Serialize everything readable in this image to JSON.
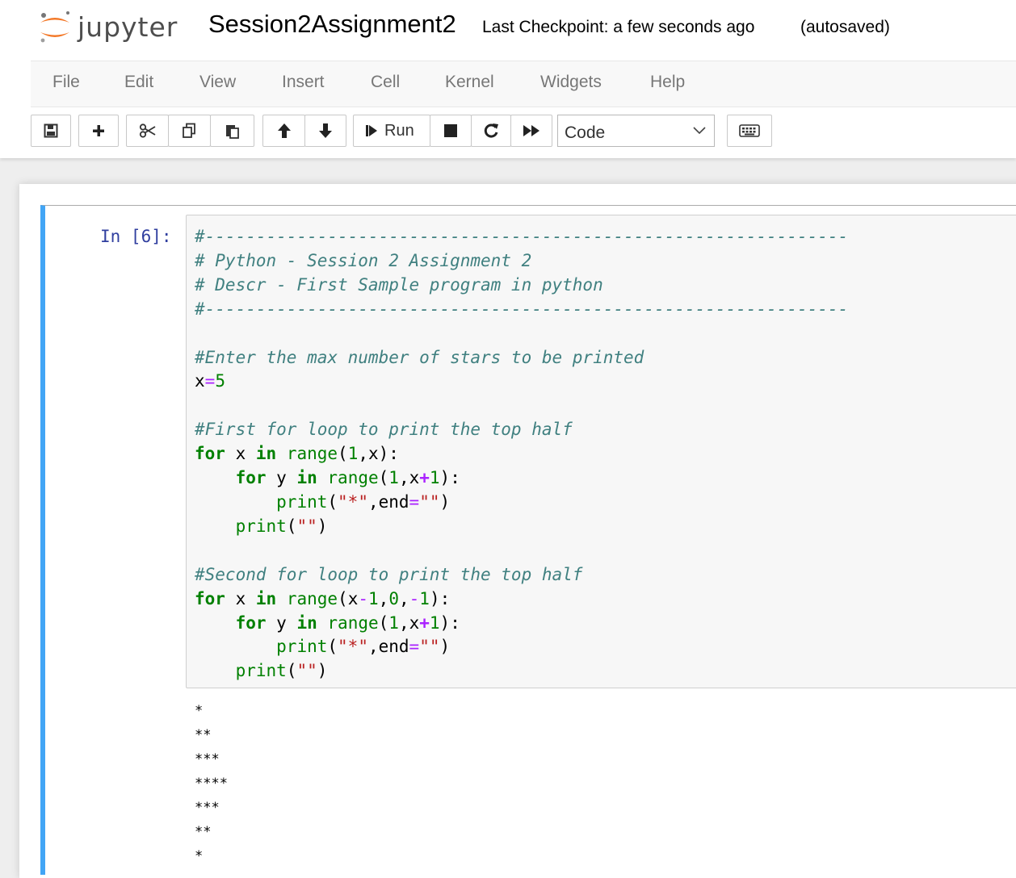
{
  "header": {
    "logo_text": "jupyter",
    "notebook_name": "Session2Assignment2",
    "checkpoint": "Last Checkpoint: a few seconds ago",
    "autosave": "(autosaved)"
  },
  "menu": [
    "File",
    "Edit",
    "View",
    "Insert",
    "Cell",
    "Kernel",
    "Widgets",
    "Help"
  ],
  "toolbar": {
    "run_label": "Run",
    "cell_type": "Code"
  },
  "cell": {
    "prompt": "In [6]:",
    "code_lines": [
      [
        {
          "t": "#---------------------------------------------------------------",
          "c": "comment"
        }
      ],
      [
        {
          "t": "# Python - Session 2 Assignment 2",
          "c": "comment"
        }
      ],
      [
        {
          "t": "# Descr - First Sample program in python",
          "c": "comment"
        }
      ],
      [
        {
          "t": "#---------------------------------------------------------------",
          "c": "comment"
        }
      ],
      [],
      [
        {
          "t": "#Enter the max number of stars to be printed",
          "c": "comment"
        }
      ],
      [
        {
          "t": "x",
          "c": ""
        },
        {
          "t": "=",
          "c": "eq"
        },
        {
          "t": "5",
          "c": "number"
        }
      ],
      [],
      [
        {
          "t": "#First for loop to print the top half",
          "c": "comment"
        }
      ],
      [
        {
          "t": "for",
          "c": "keyword"
        },
        {
          "t": " x ",
          "c": ""
        },
        {
          "t": "in",
          "c": "keyword"
        },
        {
          "t": " ",
          "c": ""
        },
        {
          "t": "range",
          "c": "builtin"
        },
        {
          "t": "(",
          "c": ""
        },
        {
          "t": "1",
          "c": "number"
        },
        {
          "t": ",x):",
          "c": ""
        }
      ],
      [
        {
          "t": "    ",
          "c": ""
        },
        {
          "t": "for",
          "c": "keyword"
        },
        {
          "t": " y ",
          "c": ""
        },
        {
          "t": "in",
          "c": "keyword"
        },
        {
          "t": " ",
          "c": ""
        },
        {
          "t": "range",
          "c": "builtin"
        },
        {
          "t": "(",
          "c": ""
        },
        {
          "t": "1",
          "c": "number"
        },
        {
          "t": ",x",
          "c": ""
        },
        {
          "t": "+",
          "c": "op"
        },
        {
          "t": "1",
          "c": "number"
        },
        {
          "t": "):",
          "c": ""
        }
      ],
      [
        {
          "t": "        ",
          "c": ""
        },
        {
          "t": "print",
          "c": "builtin"
        },
        {
          "t": "(",
          "c": ""
        },
        {
          "t": "\"*\"",
          "c": "string"
        },
        {
          "t": ",end",
          "c": ""
        },
        {
          "t": "=",
          "c": "eq"
        },
        {
          "t": "\"\"",
          "c": "string"
        },
        {
          "t": ")",
          "c": ""
        }
      ],
      [
        {
          "t": "    ",
          "c": ""
        },
        {
          "t": "print",
          "c": "builtin"
        },
        {
          "t": "(",
          "c": ""
        },
        {
          "t": "\"\"",
          "c": "string"
        },
        {
          "t": ")",
          "c": ""
        }
      ],
      [],
      [
        {
          "t": "#Second for loop to print the top half",
          "c": "comment"
        }
      ],
      [
        {
          "t": "for",
          "c": "keyword"
        },
        {
          "t": " x ",
          "c": ""
        },
        {
          "t": "in",
          "c": "keyword"
        },
        {
          "t": " ",
          "c": ""
        },
        {
          "t": "range",
          "c": "builtin"
        },
        {
          "t": "(x",
          "c": ""
        },
        {
          "t": "-",
          "c": "eq"
        },
        {
          "t": "1",
          "c": "number"
        },
        {
          "t": ",",
          "c": ""
        },
        {
          "t": "0",
          "c": "number"
        },
        {
          "t": ",",
          "c": ""
        },
        {
          "t": "-",
          "c": "eq"
        },
        {
          "t": "1",
          "c": "number"
        },
        {
          "t": "):",
          "c": ""
        }
      ],
      [
        {
          "t": "    ",
          "c": ""
        },
        {
          "t": "for",
          "c": "keyword"
        },
        {
          "t": " y ",
          "c": ""
        },
        {
          "t": "in",
          "c": "keyword"
        },
        {
          "t": " ",
          "c": ""
        },
        {
          "t": "range",
          "c": "builtin"
        },
        {
          "t": "(",
          "c": ""
        },
        {
          "t": "1",
          "c": "number"
        },
        {
          "t": ",x",
          "c": ""
        },
        {
          "t": "+",
          "c": "op"
        },
        {
          "t": "1",
          "c": "number"
        },
        {
          "t": "):",
          "c": ""
        }
      ],
      [
        {
          "t": "        ",
          "c": ""
        },
        {
          "t": "print",
          "c": "builtin"
        },
        {
          "t": "(",
          "c": ""
        },
        {
          "t": "\"*\"",
          "c": "string"
        },
        {
          "t": ",end",
          "c": ""
        },
        {
          "t": "=",
          "c": "eq"
        },
        {
          "t": "\"\"",
          "c": "string"
        },
        {
          "t": ")",
          "c": ""
        }
      ],
      [
        {
          "t": "    ",
          "c": ""
        },
        {
          "t": "print",
          "c": "builtin"
        },
        {
          "t": "(",
          "c": ""
        },
        {
          "t": "\"\"",
          "c": "string"
        },
        {
          "t": ")",
          "c": ""
        }
      ]
    ],
    "output_lines": [
      "*",
      "**",
      "***",
      "****",
      "***",
      "**",
      "*"
    ]
  },
  "colors": {
    "cell_selected_border": "#42a5f5",
    "prompt_in": "#303f9f",
    "logo_orange": "#f37726"
  }
}
